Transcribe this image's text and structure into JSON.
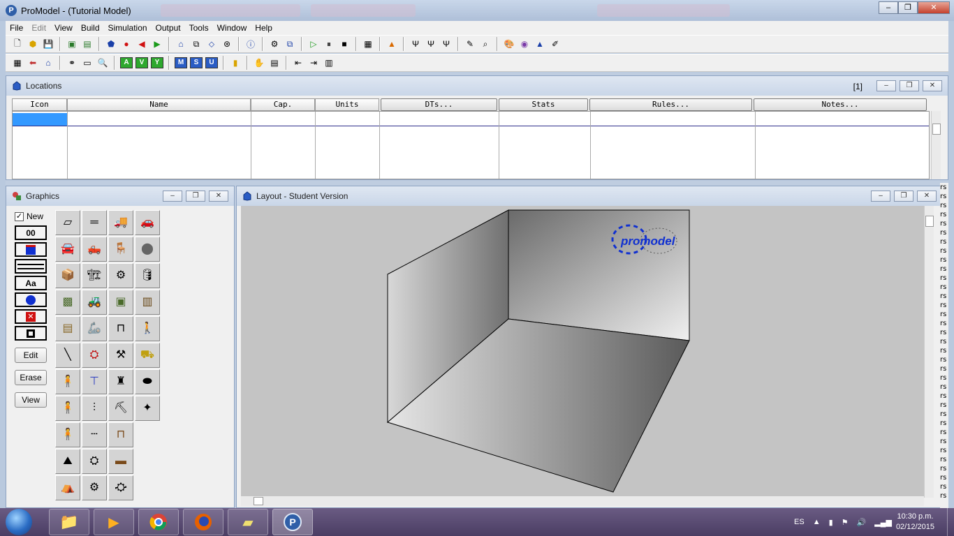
{
  "window": {
    "title": "ProModel -  (Tutorial Model)"
  },
  "menu": [
    "File",
    "Edit",
    "View",
    "Build",
    "Simulation",
    "Output",
    "Tools",
    "Window",
    "Help"
  ],
  "toolbar2_letters": [
    "A",
    "V",
    "Y",
    "M",
    "S",
    "U"
  ],
  "locations": {
    "title": "Locations",
    "count": "[1]",
    "columns": [
      "Icon",
      "Name",
      "Cap.",
      "Units"
    ],
    "button_columns": [
      "DTs...",
      "Stats",
      "Rules...",
      "Notes..."
    ]
  },
  "graphics": {
    "title": "Graphics",
    "new_label": "New",
    "tool_00": "00",
    "tool_text": "Aa",
    "edit_label": "Edit",
    "erase_label": "Erase",
    "view_label": "View"
  },
  "layout": {
    "title": "Layout - Student Version",
    "logo_text": "promodel"
  },
  "right_strip": "rs",
  "taskbar": {
    "lang": "ES",
    "time": "10:30 p.m.",
    "date": "02/12/2015"
  },
  "colors": {
    "selection": "#3399ff",
    "accent": "#2f5fa8",
    "canvas": "#c4c4c4"
  }
}
